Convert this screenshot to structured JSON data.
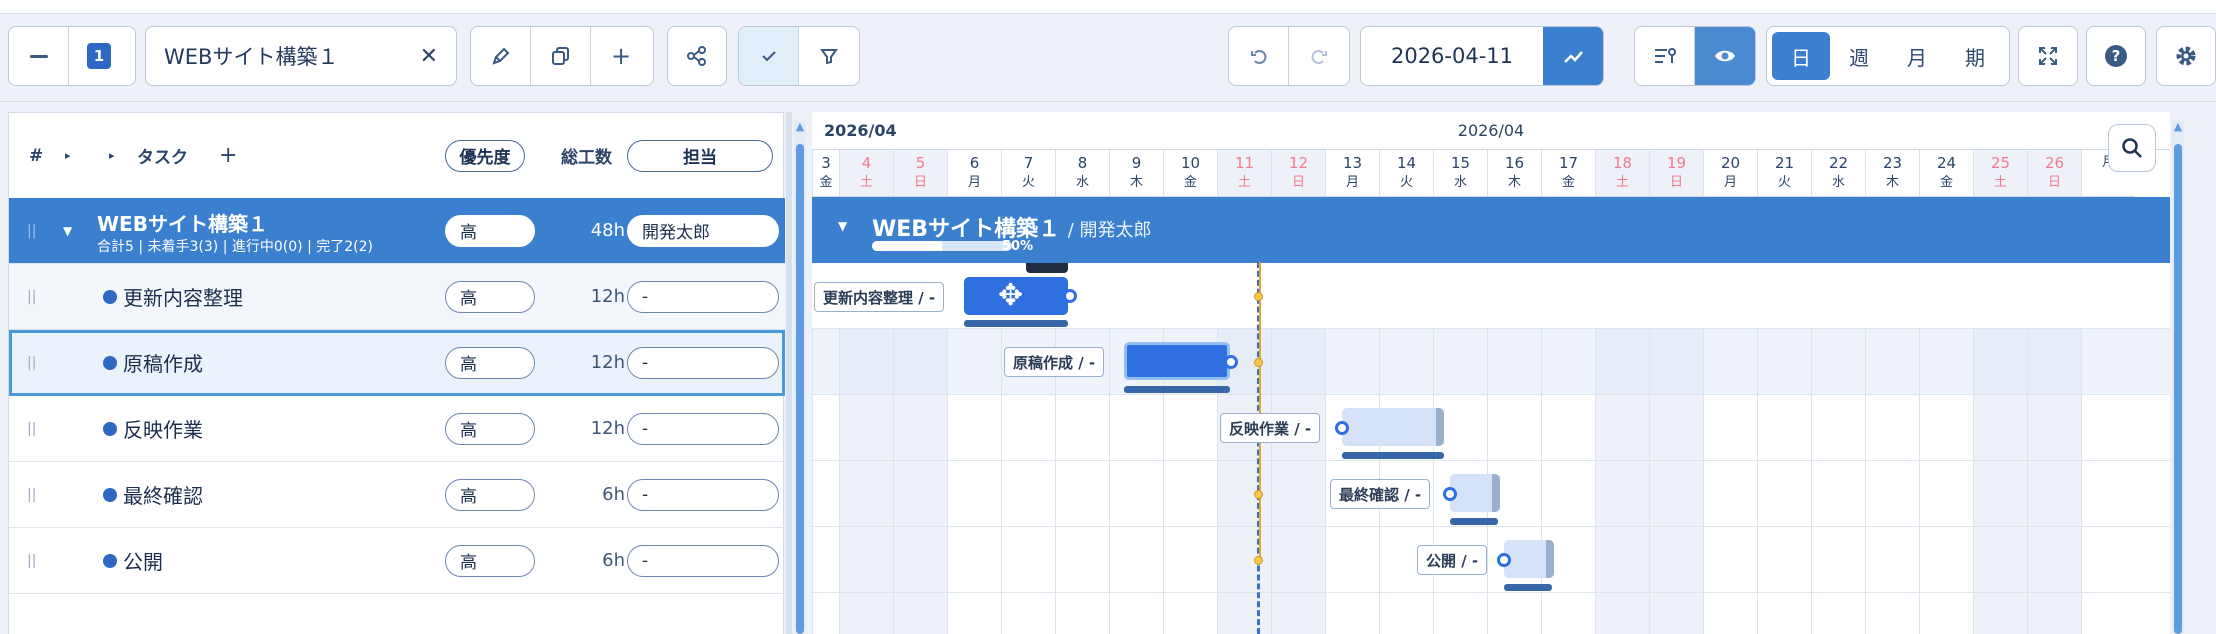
{
  "toolbar": {
    "collapse_icon": "minus-icon",
    "level_badge": "1",
    "project_name": "WEBサイト構築１",
    "clear_icon": "close-icon",
    "date": "2026-04-11"
  },
  "view_modes": [
    "日",
    "週",
    "月",
    "期"
  ],
  "active_view": "日",
  "table": {
    "col_num": "#",
    "col_task": "タスク",
    "add_symbol": "+",
    "col_priority": "優先度",
    "col_hours": "総工数",
    "col_assignee": "担当"
  },
  "parent": {
    "title": "WEBサイト構築１",
    "summary": "合計5 | 未着手3(3) | 進行中0(0) | 完了2(2)",
    "priority": "高",
    "hours": "48h",
    "assignee": "開発太郎",
    "gantt_sub": "/ 開発太郎",
    "progress_label": "50%",
    "progress": 50
  },
  "tasks": [
    {
      "name": "更新内容整理",
      "priority": "高",
      "hours": "12h",
      "assignee": "-",
      "label": "更新内容整理 / -"
    },
    {
      "name": "原稿作成",
      "priority": "高",
      "hours": "12h",
      "assignee": "-",
      "label": "原稿作成 / -"
    },
    {
      "name": "反映作業",
      "priority": "高",
      "hours": "12h",
      "assignee": "-",
      "label": "反映作業 / -"
    },
    {
      "name": "最終確認",
      "priority": "高",
      "hours": "6h",
      "assignee": "-",
      "label": "最終確認 / -"
    },
    {
      "name": "公開",
      "priority": "高",
      "hours": "6h",
      "assignee": "-",
      "label": "公開 / -"
    }
  ],
  "gantt": {
    "month_left": "2026/04",
    "month_center": "2026/04",
    "days": [
      {
        "d": "3",
        "w": "金",
        "wk": false
      },
      {
        "d": "4",
        "w": "土",
        "wk": true
      },
      {
        "d": "5",
        "w": "日",
        "wk": true
      },
      {
        "d": "6",
        "w": "月",
        "wk": false
      },
      {
        "d": "7",
        "w": "火",
        "wk": false
      },
      {
        "d": "8",
        "w": "水",
        "wk": false
      },
      {
        "d": "9",
        "w": "木",
        "wk": false
      },
      {
        "d": "10",
        "w": "金",
        "wk": false
      },
      {
        "d": "11",
        "w": "土",
        "wk": true
      },
      {
        "d": "12",
        "w": "日",
        "wk": true
      },
      {
        "d": "13",
        "w": "月",
        "wk": false
      },
      {
        "d": "14",
        "w": "火",
        "wk": false
      },
      {
        "d": "15",
        "w": "水",
        "wk": false
      },
      {
        "d": "16",
        "w": "木",
        "wk": false
      },
      {
        "d": "17",
        "w": "金",
        "wk": false
      },
      {
        "d": "18",
        "w": "土",
        "wk": true
      },
      {
        "d": "19",
        "w": "日",
        "wk": true
      },
      {
        "d": "20",
        "w": "月",
        "wk": false
      },
      {
        "d": "21",
        "w": "火",
        "wk": false
      },
      {
        "d": "22",
        "w": "水",
        "wk": false
      },
      {
        "d": "23",
        "w": "木",
        "wk": false
      },
      {
        "d": "24",
        "w": "金",
        "wk": false
      },
      {
        "d": "25",
        "w": "土",
        "wk": true
      },
      {
        "d": "26",
        "w": "日",
        "wk": true
      },
      {
        "d": "",
        "w": "月",
        "wk": false
      }
    ]
  },
  "colors": {
    "accent": "#3b7fcf",
    "bar_done": "#2f6fe0",
    "weekend_text": "#f17b8f"
  }
}
